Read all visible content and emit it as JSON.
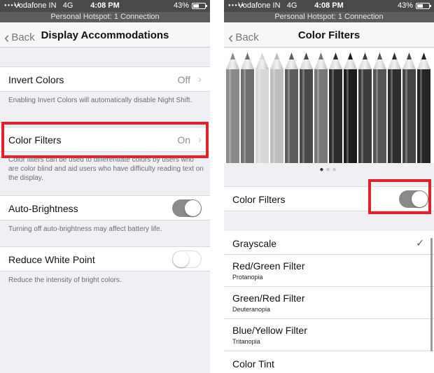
{
  "status": {
    "carrier": "Vodafone IN",
    "network": "4G",
    "time": "4:08 PM",
    "battery": "43%",
    "battery_level": 0.43,
    "hotspot": "Personal Hotspot: 1 Connection"
  },
  "left": {
    "back_label": "Back",
    "title": "Display Accommodations",
    "invert_colors": {
      "label": "Invert Colors",
      "value": "Off"
    },
    "invert_note": "Enabling Invert Colors will automatically disable Night Shift.",
    "color_filters": {
      "label": "Color Filters",
      "value": "On"
    },
    "color_filters_note": "Color filters can be used to differentiate colors by users who are color blind and aid users who have difficulty reading text on the display.",
    "auto_brightness": {
      "label": "Auto-Brightness",
      "on": true
    },
    "auto_brightness_note": "Turning off auto-brightness may affect battery life.",
    "reduce_white_point": {
      "label": "Reduce White Point",
      "on": false
    },
    "reduce_white_point_note": "Reduce the intensity of bright colors."
  },
  "right": {
    "back_label": "Back",
    "title": "Color Filters",
    "page_dots": 3,
    "active_dot": 0,
    "color_filters_toggle": {
      "label": "Color Filters",
      "on": true
    },
    "filters": [
      {
        "name": "Grayscale",
        "sub": "",
        "selected": true
      },
      {
        "name": "Red/Green Filter",
        "sub": "Protanopia",
        "selected": false
      },
      {
        "name": "Green/Red Filter",
        "sub": "Deuteranopia",
        "selected": false
      },
      {
        "name": "Blue/Yellow Filter",
        "sub": "Tritanopia",
        "selected": false
      },
      {
        "name": "Color Tint",
        "sub": "",
        "selected": false
      }
    ]
  },
  "colors": {
    "highlight": "#e2222b",
    "toggle_on": "#8a8a8a",
    "background": "#efeff4"
  },
  "icons": [
    "signal-icon",
    "battery-icon",
    "back-chevron-icon",
    "disclosure-arrow-icon",
    "checkmark-icon",
    "pencils-image"
  ]
}
